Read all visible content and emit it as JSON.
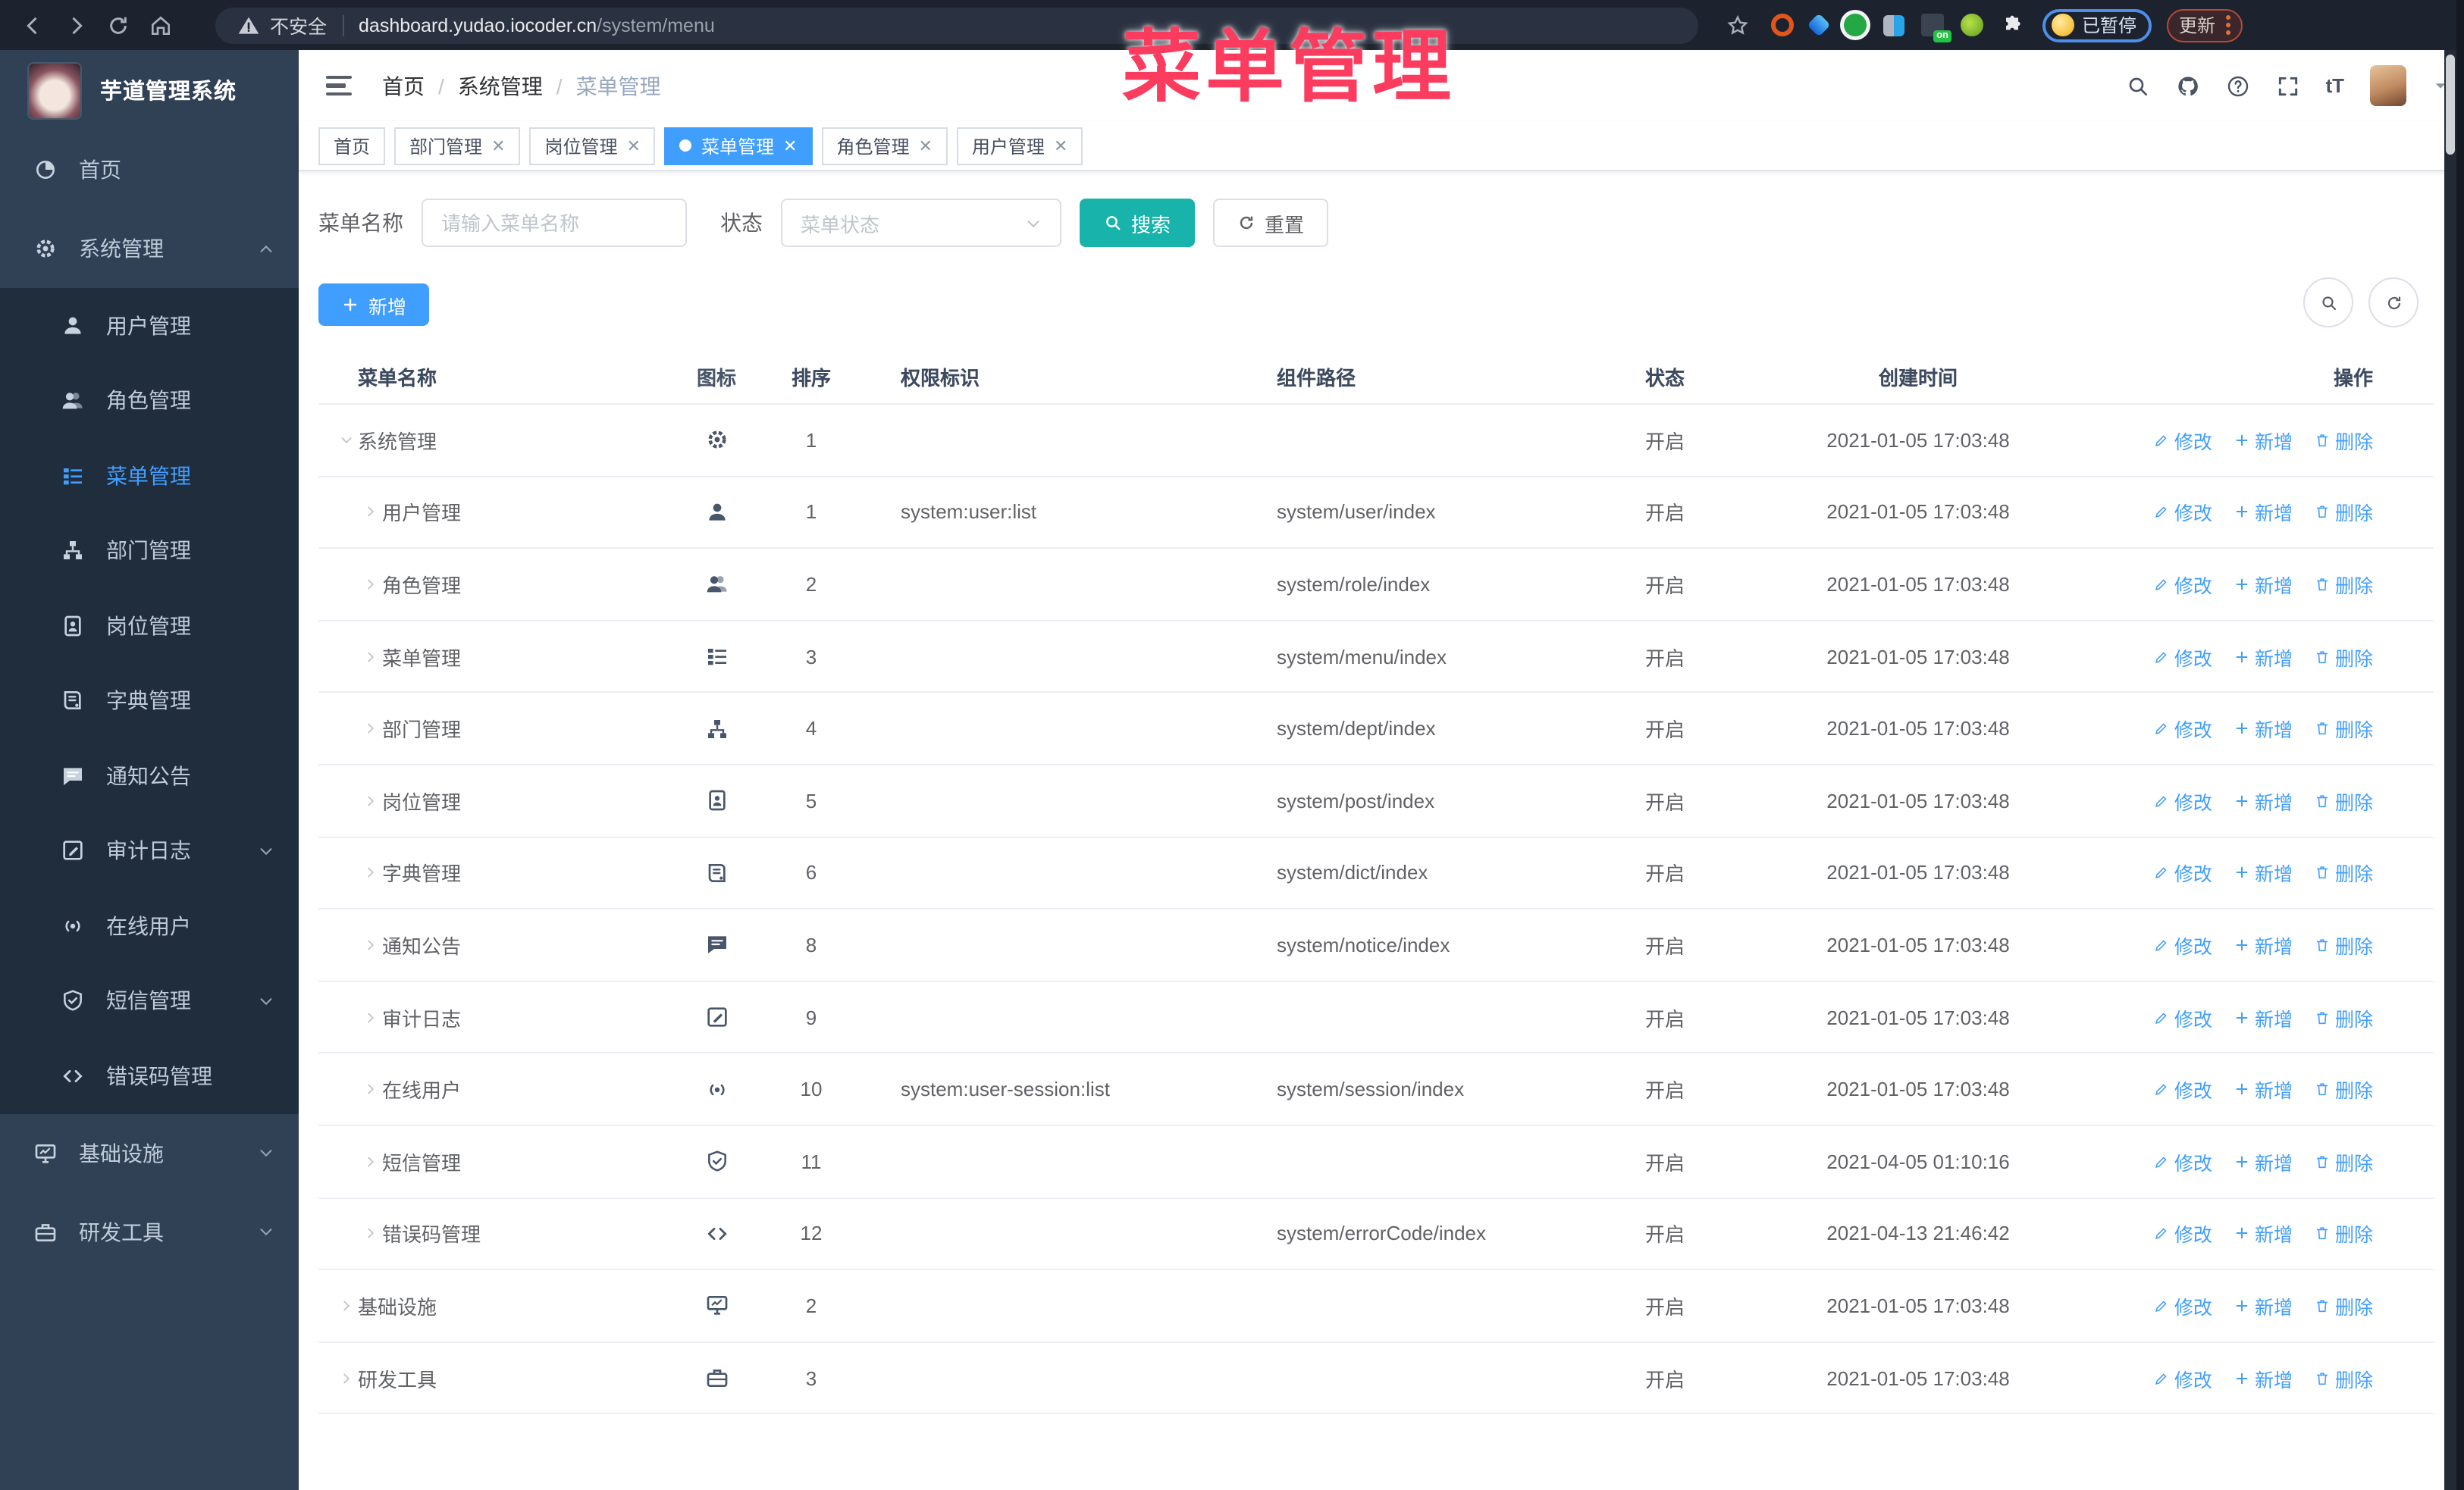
{
  "colors": {
    "accent": "#409EFF",
    "teal": "#18B3AA",
    "pink": "#FB3C5F",
    "sidebar_bg": "#304156",
    "submenu_bg": "#1F2D3D"
  },
  "overlay_text": "菜单管理",
  "browser": {
    "security_label": "不安全",
    "url_host": "dashboard.yudao.iocoder.cn",
    "url_path": "/system/menu",
    "extension_badge": "on",
    "profile_label": "已暂停",
    "update_label": "更新"
  },
  "sidebar": {
    "title": "芋道管理系统",
    "menu": [
      {
        "label": "首页",
        "icon": "dashboard",
        "level": 0
      },
      {
        "label": "系统管理",
        "icon": "gear",
        "level": 0,
        "expanded": true,
        "chevron": "up"
      },
      {
        "label": "用户管理",
        "icon": "user",
        "level": 1
      },
      {
        "label": "角色管理",
        "icon": "users",
        "level": 1
      },
      {
        "label": "菜单管理",
        "icon": "menu-list",
        "level": 1,
        "active": true
      },
      {
        "label": "部门管理",
        "icon": "org-tree",
        "level": 1
      },
      {
        "label": "岗位管理",
        "icon": "id-badge",
        "level": 1
      },
      {
        "label": "字典管理",
        "icon": "book",
        "level": 1
      },
      {
        "label": "通知公告",
        "icon": "chat",
        "level": 1
      },
      {
        "label": "审计日志",
        "icon": "edit-log",
        "level": 1,
        "chevron": "down"
      },
      {
        "label": "在线用户",
        "icon": "online",
        "level": 1
      },
      {
        "label": "短信管理",
        "icon": "shield-check",
        "level": 1,
        "chevron": "down"
      },
      {
        "label": "错误码管理",
        "icon": "code",
        "level": 1
      },
      {
        "label": "基础设施",
        "icon": "monitor",
        "level": 0,
        "chevron": "down"
      },
      {
        "label": "研发工具",
        "icon": "toolbox",
        "level": 0,
        "chevron": "down"
      }
    ]
  },
  "header": {
    "breadcrumb": [
      "首页",
      "系统管理",
      "菜单管理"
    ]
  },
  "tags": [
    {
      "label": "首页"
    },
    {
      "label": "部门管理",
      "closable": true
    },
    {
      "label": "岗位管理",
      "closable": true
    },
    {
      "label": "菜单管理",
      "closable": true,
      "active": true
    },
    {
      "label": "角色管理",
      "closable": true
    },
    {
      "label": "用户管理",
      "closable": true
    }
  ],
  "filter": {
    "name_label": "菜单名称",
    "name_placeholder": "请输入菜单名称",
    "status_label": "状态",
    "status_placeholder": "菜单状态",
    "search_label": "搜索",
    "reset_label": "重置"
  },
  "toolbar": {
    "add_label": "新增"
  },
  "table": {
    "columns": [
      "菜单名称",
      "图标",
      "排序",
      "权限标识",
      "组件路径",
      "状态",
      "创建时间",
      "操作"
    ],
    "action_labels": {
      "edit": "修改",
      "add": "新增",
      "delete": "删除"
    },
    "rows": [
      {
        "name": "系统管理",
        "icon": "gear",
        "sort": "1",
        "perm": "",
        "path": "",
        "status": "开启",
        "time": "2021-01-05 17:03:48",
        "level": 0,
        "expanded": true
      },
      {
        "name": "用户管理",
        "icon": "user",
        "sort": "1",
        "perm": "system:user:list",
        "path": "system/user/index",
        "status": "开启",
        "time": "2021-01-05 17:03:48",
        "level": 1
      },
      {
        "name": "角色管理",
        "icon": "users",
        "sort": "2",
        "perm": "",
        "path": "system/role/index",
        "status": "开启",
        "time": "2021-01-05 17:03:48",
        "level": 1
      },
      {
        "name": "菜单管理",
        "icon": "menu-list",
        "sort": "3",
        "perm": "",
        "path": "system/menu/index",
        "status": "开启",
        "time": "2021-01-05 17:03:48",
        "level": 1
      },
      {
        "name": "部门管理",
        "icon": "org-tree",
        "sort": "4",
        "perm": "",
        "path": "system/dept/index",
        "status": "开启",
        "time": "2021-01-05 17:03:48",
        "level": 1
      },
      {
        "name": "岗位管理",
        "icon": "id-badge",
        "sort": "5",
        "perm": "",
        "path": "system/post/index",
        "status": "开启",
        "time": "2021-01-05 17:03:48",
        "level": 1
      },
      {
        "name": "字典管理",
        "icon": "book",
        "sort": "6",
        "perm": "",
        "path": "system/dict/index",
        "status": "开启",
        "time": "2021-01-05 17:03:48",
        "level": 1
      },
      {
        "name": "通知公告",
        "icon": "chat",
        "sort": "8",
        "perm": "",
        "path": "system/notice/index",
        "status": "开启",
        "time": "2021-01-05 17:03:48",
        "level": 1
      },
      {
        "name": "审计日志",
        "icon": "edit-log",
        "sort": "9",
        "perm": "",
        "path": "",
        "status": "开启",
        "time": "2021-01-05 17:03:48",
        "level": 1
      },
      {
        "name": "在线用户",
        "icon": "online",
        "sort": "10",
        "perm": "system:user-session:list",
        "path": "system/session/index",
        "status": "开启",
        "time": "2021-01-05 17:03:48",
        "level": 1
      },
      {
        "name": "短信管理",
        "icon": "shield-check",
        "sort": "11",
        "perm": "",
        "path": "",
        "status": "开启",
        "time": "2021-04-05 01:10:16",
        "level": 1
      },
      {
        "name": "错误码管理",
        "icon": "code",
        "sort": "12",
        "perm": "",
        "path": "system/errorCode/index",
        "status": "开启",
        "time": "2021-04-13 21:46:42",
        "level": 1
      },
      {
        "name": "基础设施",
        "icon": "monitor",
        "sort": "2",
        "perm": "",
        "path": "",
        "status": "开启",
        "time": "2021-01-05 17:03:48",
        "level": 0
      },
      {
        "name": "研发工具",
        "icon": "toolbox",
        "sort": "3",
        "perm": "",
        "path": "",
        "status": "开启",
        "time": "2021-01-05 17:03:48",
        "level": 0
      }
    ]
  }
}
